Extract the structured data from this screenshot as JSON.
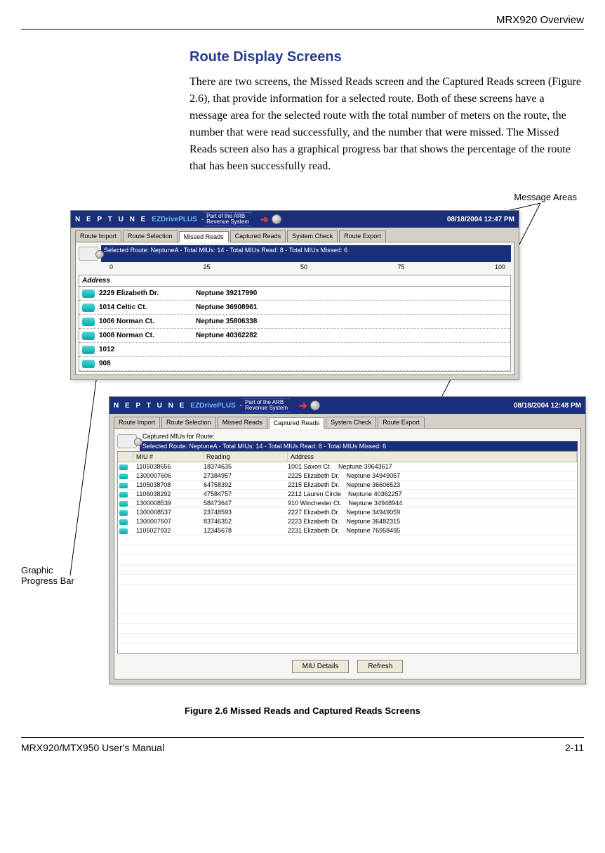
{
  "page": {
    "header_right": "MRX920 Overview",
    "footer_left": "MRX920/MTX950 User's Manual",
    "footer_right": "2-11"
  },
  "section": {
    "title": "Route Display Screens",
    "paragraph": "There are two screens, the Missed Reads screen and the Captured Reads screen (Figure 2.6), that provide information for a selected route. Both of these screens have a message area for the selected route with the total number of meters on the route, the number that were read successfully, and the number that were missed. The Missed Reads screen also has a graphical progress bar that shows the percentage of the route that has been successfully read."
  },
  "callouts": {
    "message_areas": "Message Areas",
    "progress_bar": "Graphic\nProgress Bar"
  },
  "app_common": {
    "brand": "N E P T U N E",
    "product": "EZDrivePLUS",
    "tagline_top": "Part of the ARB",
    "tagline_bottom": "Revenue System",
    "tabs": [
      "Route Import",
      "Route Selection",
      "Missed Reads",
      "Captured Reads",
      "System Check",
      "Route Export"
    ]
  },
  "missed_window": {
    "datetime": "08/18/2004 12:47 PM",
    "active_tab_index": 2,
    "message": "Selected Route: NeptuneA - Total MIUs: 14 - Total MIUs Read: 8 - Total MIUs Missed: 6",
    "scale": [
      "0",
      "25",
      "50",
      "75",
      "100"
    ],
    "address_header": "Address",
    "rows": [
      {
        "addr": "2229 Elizabeth Dr.",
        "acct": "Neptune 39217990"
      },
      {
        "addr": "1014 Celtic Ct.",
        "acct": "Neptune 36908961"
      },
      {
        "addr": "1006 Norman Ct.",
        "acct": "Neptune 35806338"
      },
      {
        "addr": "1008 Norman Ct.",
        "acct": "Neptune 40362282"
      },
      {
        "addr": "1012",
        "acct": ""
      },
      {
        "addr": "908",
        "acct": ""
      }
    ]
  },
  "captured_window": {
    "datetime": "08/18/2004 12:48 PM",
    "active_tab_index": 3,
    "sub_label": "Captured MIUs for Route:",
    "message": "Selected Route: NeptuneA - Total MIUs: 14 - Total MIUs Read: 8 - Total MIUs Missed: 6",
    "columns": {
      "miu": "MIU #",
      "reading": "Reading",
      "address": "Address"
    },
    "rows": [
      {
        "miu": "1105038656",
        "reading": "18374635",
        "addr": "1001 Saxon Ct.",
        "acct": "Neptune 39643617"
      },
      {
        "miu": "1300007606",
        "reading": "27384957",
        "addr": "2225 Elizabeth Dr.",
        "acct": "Neptune 34949057"
      },
      {
        "miu": "1105038708",
        "reading": "64758392",
        "addr": "2215 Elizabeth Dr.",
        "acct": "Neptune 36606523"
      },
      {
        "miu": "1106038292",
        "reading": "47584757",
        "addr": "2212 Lauren Circle",
        "acct": "Neptune 40362257"
      },
      {
        "miu": "1300008539",
        "reading": "58473647",
        "addr": "910 Winchester Ct.",
        "acct": "Neptune 34948944"
      },
      {
        "miu": "1300008537",
        "reading": "23748593",
        "addr": "2227 Elizabeth Dr.",
        "acct": "Neptune 34949059"
      },
      {
        "miu": "1300007607",
        "reading": "83746352",
        "addr": "2223 Elizabeth Dr.",
        "acct": "Neptune 36482315"
      },
      {
        "miu": "1105027932",
        "reading": "12345678",
        "addr": "2231 Elizabeth Dr.",
        "acct": "Neptune 76958495"
      }
    ],
    "blank_rows": 12,
    "buttons": {
      "details": "MIU Details",
      "refresh": "Refresh"
    }
  },
  "figure": {
    "caption": "Figure 2.6   Missed Reads and Captured Reads Screens"
  }
}
